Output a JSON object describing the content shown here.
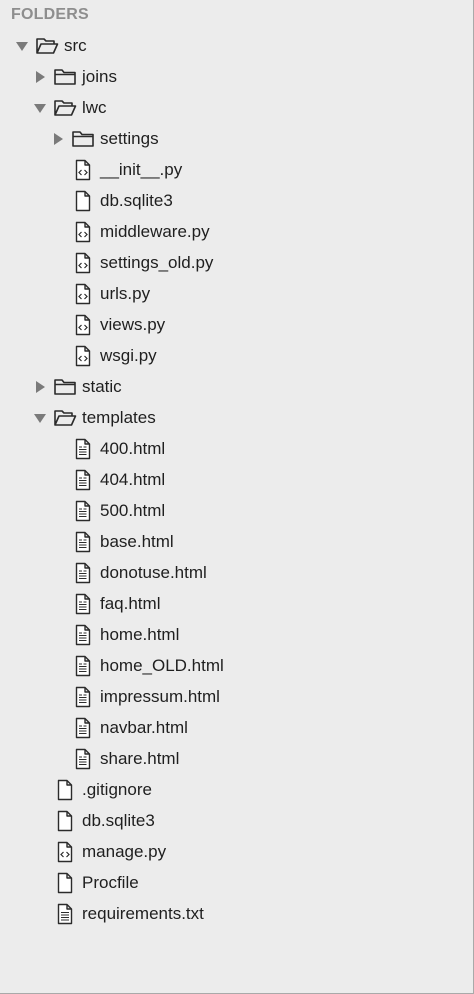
{
  "header": "FOLDERS",
  "tree": [
    {
      "label": "src",
      "depth": 0,
      "kind": "folder",
      "expanded": true
    },
    {
      "label": "joins",
      "depth": 1,
      "kind": "folder",
      "expanded": false
    },
    {
      "label": "lwc",
      "depth": 1,
      "kind": "folder",
      "expanded": true
    },
    {
      "label": "settings",
      "depth": 2,
      "kind": "folder",
      "expanded": false
    },
    {
      "label": "__init__.py",
      "depth": 2,
      "kind": "file-code"
    },
    {
      "label": "db.sqlite3",
      "depth": 2,
      "kind": "file"
    },
    {
      "label": "middleware.py",
      "depth": 2,
      "kind": "file-code"
    },
    {
      "label": "settings_old.py",
      "depth": 2,
      "kind": "file-code"
    },
    {
      "label": "urls.py",
      "depth": 2,
      "kind": "file-code"
    },
    {
      "label": "views.py",
      "depth": 2,
      "kind": "file-code"
    },
    {
      "label": "wsgi.py",
      "depth": 2,
      "kind": "file-code"
    },
    {
      "label": "static",
      "depth": 1,
      "kind": "folder",
      "expanded": false
    },
    {
      "label": "templates",
      "depth": 1,
      "kind": "folder",
      "expanded": true
    },
    {
      "label": "400.html",
      "depth": 2,
      "kind": "file-html"
    },
    {
      "label": "404.html",
      "depth": 2,
      "kind": "file-html"
    },
    {
      "label": "500.html",
      "depth": 2,
      "kind": "file-html"
    },
    {
      "label": "base.html",
      "depth": 2,
      "kind": "file-html"
    },
    {
      "label": "donotuse.html",
      "depth": 2,
      "kind": "file-html"
    },
    {
      "label": "faq.html",
      "depth": 2,
      "kind": "file-html"
    },
    {
      "label": "home.html",
      "depth": 2,
      "kind": "file-html"
    },
    {
      "label": "home_OLD.html",
      "depth": 2,
      "kind": "file-html"
    },
    {
      "label": "impressum.html",
      "depth": 2,
      "kind": "file-html"
    },
    {
      "label": "navbar.html",
      "depth": 2,
      "kind": "file-html"
    },
    {
      "label": "share.html",
      "depth": 2,
      "kind": "file-html"
    },
    {
      "label": ".gitignore",
      "depth": 1,
      "kind": "file"
    },
    {
      "label": "db.sqlite3",
      "depth": 1,
      "kind": "file"
    },
    {
      "label": "manage.py",
      "depth": 1,
      "kind": "file-code"
    },
    {
      "label": "Procfile",
      "depth": 1,
      "kind": "file"
    },
    {
      "label": "requirements.txt",
      "depth": 1,
      "kind": "file-text"
    }
  ]
}
